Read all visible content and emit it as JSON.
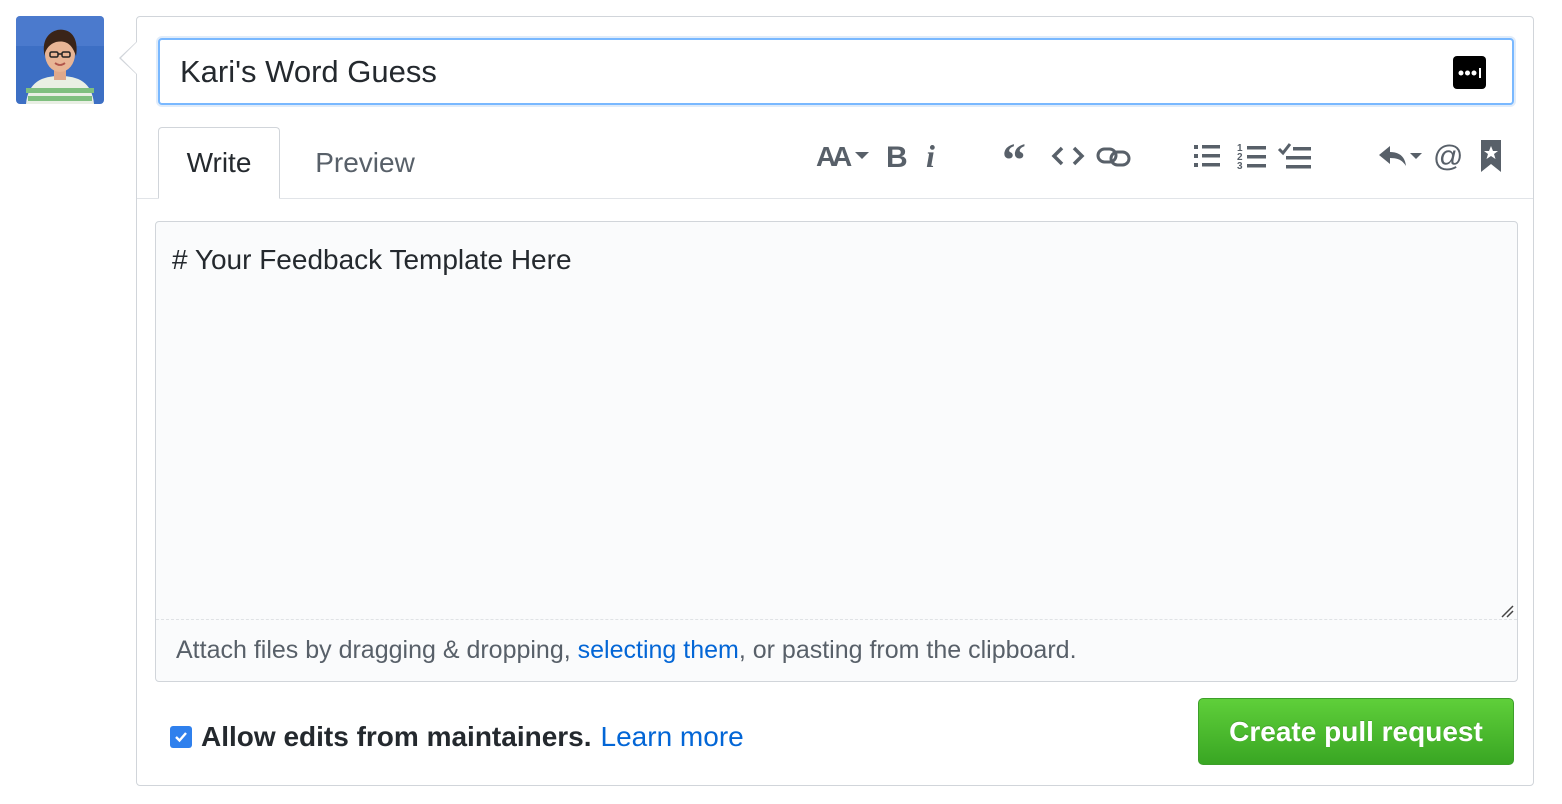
{
  "pr_form": {
    "title_value": "Kari's Word Guess",
    "tabs": [
      {
        "label": "Write",
        "selected": true
      },
      {
        "label": "Preview",
        "selected": false
      }
    ],
    "toolbar_icons": [
      "text-size-icon",
      "bold-icon",
      "italic-icon",
      "quote-icon",
      "code-icon",
      "link-icon",
      "unordered-list-icon",
      "ordered-list-icon",
      "task-list-icon",
      "reply-icon",
      "mention-icon",
      "bookmark-icon"
    ],
    "body_value": "# Your Feedback Template Here",
    "attach": {
      "prefix": "Attach files by dragging & dropping, ",
      "link": "selecting them",
      "suffix": ", or pasting from the clipboard."
    },
    "allow_edits": {
      "checked": true,
      "label": "Allow edits from maintainers.",
      "learn_more": "Learn more"
    },
    "submit_label": "Create pull request"
  },
  "colors": {
    "focus_border": "#79b8ff",
    "link": "#0366d6",
    "button_green": "#4cbb30",
    "checkbox_blue": "#2f80ed"
  }
}
